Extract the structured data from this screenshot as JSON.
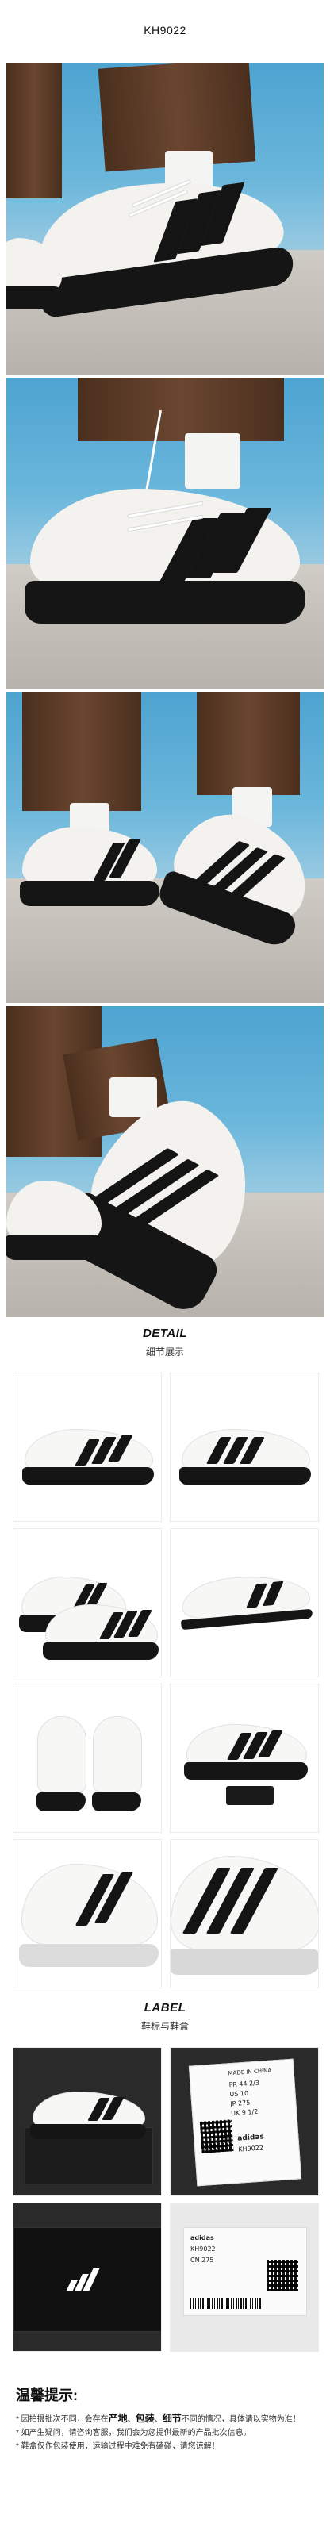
{
  "header": {
    "product_code": "KH9022"
  },
  "detail": {
    "title_en": "DETAIL",
    "title_cn": "细节展示"
  },
  "label": {
    "title_en": "LABEL",
    "title_cn": "鞋标与鞋盒"
  },
  "shoe_label": {
    "made_in": "MADE IN CHINA",
    "size_fr": "FR 44 2/3",
    "size_us": "US 10",
    "size_jp": "JP 275",
    "size_cn": "CN 275",
    "size_uk": "UK 9 1/2",
    "brand": "adidas",
    "code": "KH9022"
  },
  "tips": {
    "title": "温馨提示:",
    "line1_prefix": "* 因拍摄批次不同，会存在",
    "kw1": "产地",
    "sep1": "、",
    "kw2": "包装",
    "sep2": "、",
    "kw3": "细节",
    "line1_suffix": "不同的情况，具体请以实物为准！",
    "line2": "* 如产生疑问，请咨询客服，我们会为您提供最新的产品批次信息。",
    "line3": "* 鞋盒仅作包装使用，运输过程中难免有磕碰，请您谅解！"
  },
  "colors": {
    "sky": "#5aaad6",
    "trouser": "#5a3a26",
    "sole": "#151515",
    "upper": "#f3f2ee"
  }
}
